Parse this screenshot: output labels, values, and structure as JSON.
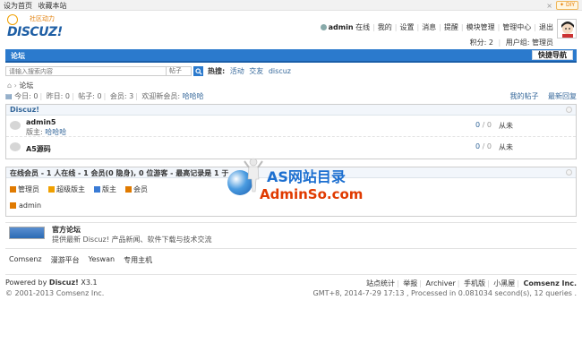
{
  "topbar": {
    "set_home": "设为首页",
    "bookmark": "收藏本站",
    "diy": "DIY"
  },
  "logo": {
    "subtitle": "社区动力",
    "name": "DISCUZ!"
  },
  "usernav": {
    "username": "admin",
    "status": "在线",
    "my": "我的",
    "settings": "设置",
    "messages": "消息",
    "reminders": "提醒",
    "module_admin": "模块管理",
    "admin_center": "管理中心",
    "logout": "退出"
  },
  "userinfo": {
    "points": "积分: 2",
    "group": "用户组: 管理员"
  },
  "navbar": {
    "tab": "论坛",
    "quick_nav": "快捷导航"
  },
  "search": {
    "placeholder": "请输入搜索内容",
    "type": "帖子",
    "hot_label": "热搜:",
    "hot_words": [
      "活动",
      "交友",
      "discuz"
    ]
  },
  "breadcrumb": {
    "current": "论坛"
  },
  "stats": {
    "today": "今日: 0",
    "yesterday": "昨日: 0",
    "posts": "帖子: 0",
    "members": "会员: 3",
    "welcome_label": "欢迎新会员: ",
    "newest_member": "哈哈哈"
  },
  "postlinks": {
    "my_posts": "我的帖子",
    "latest_replies": "最新回复"
  },
  "forum_group": {
    "title": "Discuz!",
    "forums": [
      {
        "name": "admin5",
        "mod_label": "版主: ",
        "moderator": "哈哈哈",
        "threads": "0",
        "posts": "0",
        "last": "从未"
      },
      {
        "name": "A5源码",
        "mod_label": "",
        "moderator": "",
        "threads": "0",
        "posts": "0",
        "last": "从未"
      }
    ]
  },
  "online": {
    "title": "在线会员 - 1 人在线 - 1 会员(0 隐身), 0 位游客 - 最高记录是 1 于",
    "legend": [
      {
        "label": "管理员",
        "color": "#e07a00"
      },
      {
        "label": "超级版主",
        "color": "#f0a000"
      },
      {
        "label": "版主",
        "color": "#3a7bd5"
      },
      {
        "label": "会员",
        "color": "#e07a00"
      }
    ],
    "members": [
      "admin"
    ]
  },
  "official": {
    "title": "官方论坛",
    "desc": "提供最新 Discuz! 产品新闻、软件下载与技术交流"
  },
  "links": [
    "Comsenz",
    "漫游平台",
    "Yeswan",
    "专用主机"
  ],
  "footer": {
    "powered_prefix": "Powered by ",
    "product": "Discuz!",
    "version": " X3.1",
    "copyright": "© 2001-2013 Comsenz Inc.",
    "links": [
      "站点统计",
      "举报",
      "Archiver",
      "手机版",
      "小黑屋",
      "Comsenz Inc."
    ],
    "gmt": "GMT+8, 2014-7-29 17:13 , Processed in 0.081034 second(s), 12 queries ."
  },
  "watermark": {
    "line1": "AS网站目录",
    "line2": "AdminSo.com"
  }
}
